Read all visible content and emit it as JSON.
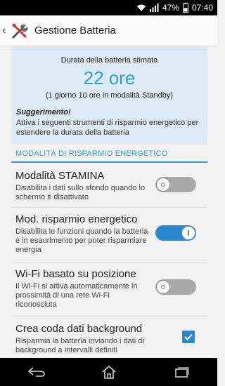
{
  "statusbar": {
    "battery_percent": "47%",
    "time": "07:40"
  },
  "actionbar": {
    "title": "Gestione Batteria"
  },
  "estimate": {
    "label": "Durata della batteria stimata",
    "value": "22 ore",
    "standby": "(1 giorno 10 ore in modalità Standby)",
    "tip_title": "Suggerimento!",
    "tip_body": "Attiva i seguenti strumenti di risparmio energetico per estendere la durata della batteria"
  },
  "section": {
    "header": "MODALITÀ DI RISPARMIO ENERGETICO"
  },
  "settings": [
    {
      "title": "Modalità STAMINA",
      "description": "Disabilita i dati sullo sfondo quando lo schermo è disattivato",
      "control": "toggle",
      "enabled": false
    },
    {
      "title": "Mod. risparmio energetico",
      "description": "Disabilita le funzioni quando la batteria è in esaurimento per poter risparmiare energia",
      "control": "toggle",
      "enabled": true
    },
    {
      "title": "Wi-Fi basato su posizione",
      "description": "Il Wi-Fi si attiva automaticamente in prossimità di una rete Wi-Fi riconosciuta",
      "control": "toggle",
      "enabled": false
    },
    {
      "title": "Crea coda dati background",
      "description": "Risparmia la batteria inviando i dati di background a intervalli definiti",
      "control": "checkbox",
      "enabled": true
    }
  ],
  "colors": {
    "accent": "#2aa0d8",
    "toggle_on": "#2a88cf",
    "toggle_off": "#a9a9a9",
    "info_bg": "#dbeaf4"
  },
  "icons": {
    "statusbar": [
      "wifi-icon",
      "signal-icon",
      "battery-icon"
    ],
    "actionbar": [
      "back-chevron-icon",
      "battery-manager-app-icon"
    ],
    "navbar": [
      "back-icon",
      "home-icon",
      "recent-apps-icon"
    ]
  }
}
